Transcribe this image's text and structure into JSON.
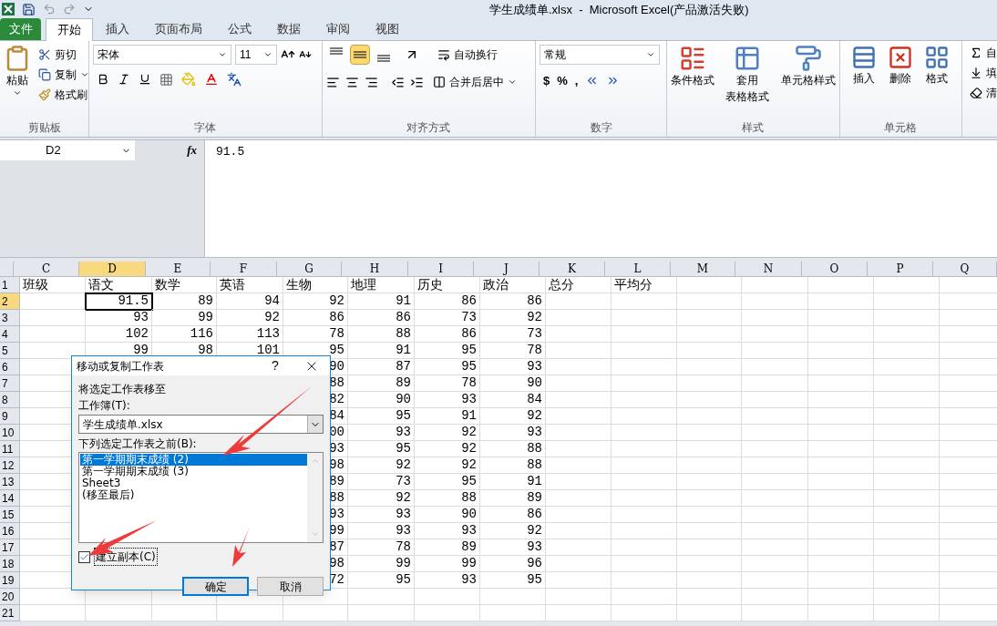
{
  "title": "学生成绩单.xlsx  -  Microsoft Excel(产品激活失败)",
  "tabs": [
    {
      "label": "文件",
      "kind": "file",
      "selected": false
    },
    {
      "label": "开始",
      "kind": "tab",
      "selected": true
    },
    {
      "label": "插入",
      "kind": "tab",
      "selected": false
    },
    {
      "label": "页面布局",
      "kind": "tab",
      "selected": false
    },
    {
      "label": "公式",
      "kind": "tab",
      "selected": false
    },
    {
      "label": "数据",
      "kind": "tab",
      "selected": false
    },
    {
      "label": "审阅",
      "kind": "tab",
      "selected": false
    },
    {
      "label": "视图",
      "kind": "tab",
      "selected": false
    }
  ],
  "clipboard": {
    "paste": "粘贴",
    "cut": "剪切",
    "copy": "复制",
    "format_painter": "格式刷",
    "label": "剪贴板"
  },
  "font": {
    "name": "宋体",
    "size": "11",
    "label": "字体"
  },
  "alignment": {
    "vertical": [
      {
        "selected": false
      },
      {
        "selected": true
      },
      {
        "selected": false
      }
    ],
    "wrap": "自动换行",
    "merge": "合并后居中",
    "label": "对齐方式"
  },
  "number": {
    "format": "常规",
    "currency": "$",
    "percent": "%",
    "comma": ",",
    "label": "数字"
  },
  "styles": {
    "conditional": "条件格式",
    "table_1": "套用",
    "table_2": "表格格式",
    "cell_styles": "单元格样式",
    "label": "样式"
  },
  "cells": {
    "items": [
      "插入",
      "删除",
      "格式"
    ],
    "label": "单元格"
  },
  "editing": {
    "items": [
      "自",
      "填",
      "清"
    ]
  },
  "formula_bar": {
    "name_box": "D2",
    "fx": "fx",
    "value": "91.5"
  },
  "sheet": {
    "columns": [
      {
        "label": "C",
        "selected": false
      },
      {
        "label": "D",
        "selected": true
      },
      {
        "label": "E",
        "selected": false
      },
      {
        "label": "F",
        "selected": false
      },
      {
        "label": "G",
        "selected": false
      },
      {
        "label": "H",
        "selected": false
      },
      {
        "label": "I",
        "selected": false
      },
      {
        "label": "J",
        "selected": false
      },
      {
        "label": "K",
        "selected": false
      },
      {
        "label": "L",
        "selected": false
      },
      {
        "label": "M",
        "selected": false
      },
      {
        "label": "N",
        "selected": false
      },
      {
        "label": "O",
        "selected": false
      },
      {
        "label": "P",
        "selected": false
      },
      {
        "label": "Q",
        "selected": false
      }
    ],
    "rows": [
      {
        "number": "1",
        "kind": "text",
        "selected": false,
        "cells": [
          {
            "v": "班级",
            "active": false
          },
          {
            "v": "语文",
            "active": false
          },
          {
            "v": "数学",
            "active": false
          },
          {
            "v": "英语",
            "active": false
          },
          {
            "v": "生物",
            "active": false
          },
          {
            "v": "地理",
            "active": false
          },
          {
            "v": "历史",
            "active": false
          },
          {
            "v": "政治",
            "active": false
          },
          {
            "v": "总分",
            "active": false
          },
          {
            "v": "平均分",
            "active": false
          }
        ]
      },
      {
        "number": "2",
        "kind": "number",
        "selected": true,
        "cells": [
          null,
          {
            "v": "91.5",
            "active": true
          },
          {
            "v": "89",
            "active": false
          },
          {
            "v": "94",
            "active": false
          },
          {
            "v": "92",
            "active": false
          },
          {
            "v": "91",
            "active": false
          },
          {
            "v": "86",
            "active": false
          },
          {
            "v": "86",
            "active": false
          }
        ]
      },
      {
        "number": "3",
        "kind": "number",
        "selected": false,
        "cells": [
          null,
          {
            "v": "93",
            "active": false
          },
          {
            "v": "99",
            "active": false
          },
          {
            "v": "92",
            "active": false
          },
          {
            "v": "86",
            "active": false
          },
          {
            "v": "86",
            "active": false
          },
          {
            "v": "73",
            "active": false
          },
          {
            "v": "92",
            "active": false
          }
        ]
      },
      {
        "number": "4",
        "kind": "number",
        "selected": false,
        "cells": [
          null,
          {
            "v": "102",
            "active": false
          },
          {
            "v": "116",
            "active": false
          },
          {
            "v": "113",
            "active": false
          },
          {
            "v": "78",
            "active": false
          },
          {
            "v": "88",
            "active": false
          },
          {
            "v": "86",
            "active": false
          },
          {
            "v": "73",
            "active": false
          }
        ]
      },
      {
        "number": "5",
        "kind": "number",
        "selected": false,
        "cells": [
          null,
          {
            "v": "99",
            "active": false
          },
          {
            "v": "98",
            "active": false
          },
          {
            "v": "101",
            "active": false
          },
          {
            "v": "95",
            "active": false
          },
          {
            "v": "91",
            "active": false
          },
          {
            "v": "95",
            "active": false
          },
          {
            "v": "78",
            "active": false
          }
        ]
      },
      {
        "number": "6",
        "kind": "number",
        "selected": false,
        "cells": [
          null,
          null,
          null,
          null,
          {
            "v": "90",
            "active": false
          },
          {
            "v": "87",
            "active": false
          },
          {
            "v": "95",
            "active": false
          },
          {
            "v": "93",
            "active": false
          }
        ]
      },
      {
        "number": "7",
        "kind": "number",
        "selected": false,
        "cells": [
          null,
          null,
          null,
          null,
          {
            "v": "88",
            "active": false
          },
          {
            "v": "89",
            "active": false
          },
          {
            "v": "78",
            "active": false
          },
          {
            "v": "90",
            "active": false
          }
        ]
      },
      {
        "number": "8",
        "kind": "number",
        "selected": false,
        "cells": [
          null,
          null,
          null,
          null,
          {
            "v": "82",
            "active": false
          },
          {
            "v": "90",
            "active": false
          },
          {
            "v": "93",
            "active": false
          },
          {
            "v": "84",
            "active": false
          }
        ]
      },
      {
        "number": "9",
        "kind": "number",
        "selected": false,
        "cells": [
          null,
          null,
          null,
          null,
          {
            "v": "84",
            "active": false
          },
          {
            "v": "95",
            "active": false
          },
          {
            "v": "91",
            "active": false
          },
          {
            "v": "92",
            "active": false
          }
        ]
      },
      {
        "number": "10",
        "kind": "number",
        "selected": false,
        "cells": [
          null,
          null,
          null,
          null,
          {
            "v": "00",
            "active": false
          },
          {
            "v": "93",
            "active": false
          },
          {
            "v": "92",
            "active": false
          },
          {
            "v": "93",
            "active": false
          }
        ]
      },
      {
        "number": "11",
        "kind": "number",
        "selected": false,
        "cells": [
          null,
          null,
          null,
          null,
          {
            "v": "93",
            "active": false
          },
          {
            "v": "95",
            "active": false
          },
          {
            "v": "92",
            "active": false
          },
          {
            "v": "88",
            "active": false
          }
        ]
      },
      {
        "number": "12",
        "kind": "number",
        "selected": false,
        "cells": [
          null,
          null,
          null,
          null,
          {
            "v": "98",
            "active": false
          },
          {
            "v": "92",
            "active": false
          },
          {
            "v": "92",
            "active": false
          },
          {
            "v": "88",
            "active": false
          }
        ]
      },
      {
        "number": "13",
        "kind": "number",
        "selected": false,
        "cells": [
          null,
          null,
          null,
          null,
          {
            "v": "89",
            "active": false
          },
          {
            "v": "73",
            "active": false
          },
          {
            "v": "95",
            "active": false
          },
          {
            "v": "91",
            "active": false
          }
        ]
      },
      {
        "number": "14",
        "kind": "number",
        "selected": false,
        "cells": [
          null,
          null,
          null,
          null,
          {
            "v": "88",
            "active": false
          },
          {
            "v": "92",
            "active": false
          },
          {
            "v": "88",
            "active": false
          },
          {
            "v": "89",
            "active": false
          }
        ]
      },
      {
        "number": "15",
        "kind": "number",
        "selected": false,
        "cells": [
          null,
          null,
          null,
          null,
          {
            "v": "93",
            "active": false
          },
          {
            "v": "93",
            "active": false
          },
          {
            "v": "90",
            "active": false
          },
          {
            "v": "86",
            "active": false
          }
        ]
      },
      {
        "number": "16",
        "kind": "number",
        "selected": false,
        "cells": [
          null,
          null,
          null,
          null,
          {
            "v": "99",
            "active": false
          },
          {
            "v": "93",
            "active": false
          },
          {
            "v": "93",
            "active": false
          },
          {
            "v": "92",
            "active": false
          }
        ]
      },
      {
        "number": "17",
        "kind": "number",
        "selected": false,
        "cells": [
          null,
          null,
          null,
          null,
          {
            "v": "87",
            "active": false
          },
          {
            "v": "78",
            "active": false
          },
          {
            "v": "89",
            "active": false
          },
          {
            "v": "93",
            "active": false
          }
        ]
      },
      {
        "number": "18",
        "kind": "number",
        "selected": false,
        "cells": [
          null,
          null,
          null,
          null,
          {
            "v": "98",
            "active": false
          },
          {
            "v": "99",
            "active": false
          },
          {
            "v": "99",
            "active": false
          },
          {
            "v": "96",
            "active": false
          }
        ]
      },
      {
        "number": "19",
        "kind": "number",
        "selected": false,
        "cells": [
          null,
          null,
          null,
          null,
          {
            "v": "72",
            "active": false
          },
          {
            "v": "95",
            "active": false
          },
          {
            "v": "93",
            "active": false
          },
          {
            "v": "95",
            "active": false
          }
        ]
      },
      {
        "number": "20",
        "kind": "number",
        "selected": false
      },
      {
        "number": "21",
        "kind": "number",
        "selected": false
      }
    ]
  },
  "dialog": {
    "title": "移动或复制工作表",
    "help": "?",
    "label_1": "将选定工作表移至",
    "label_2": "工作簿(T):",
    "workbook": "学生成绩单.xlsx",
    "label_3": "下列选定工作表之前(B):",
    "sheets": [
      {
        "label": "第一学期期末成绩 (2)",
        "selected": true
      },
      {
        "label": "第一学期期末成绩 (3)",
        "selected": false
      },
      {
        "label": "Sheet3",
        "selected": false
      },
      {
        "label": "(移至最后)",
        "selected": false
      }
    ],
    "copy": {
      "label": "建立副本(C)",
      "checked": true
    },
    "buttons": [
      {
        "label": "确定",
        "default": true
      },
      {
        "label": "取消",
        "default": false
      }
    ]
  }
}
